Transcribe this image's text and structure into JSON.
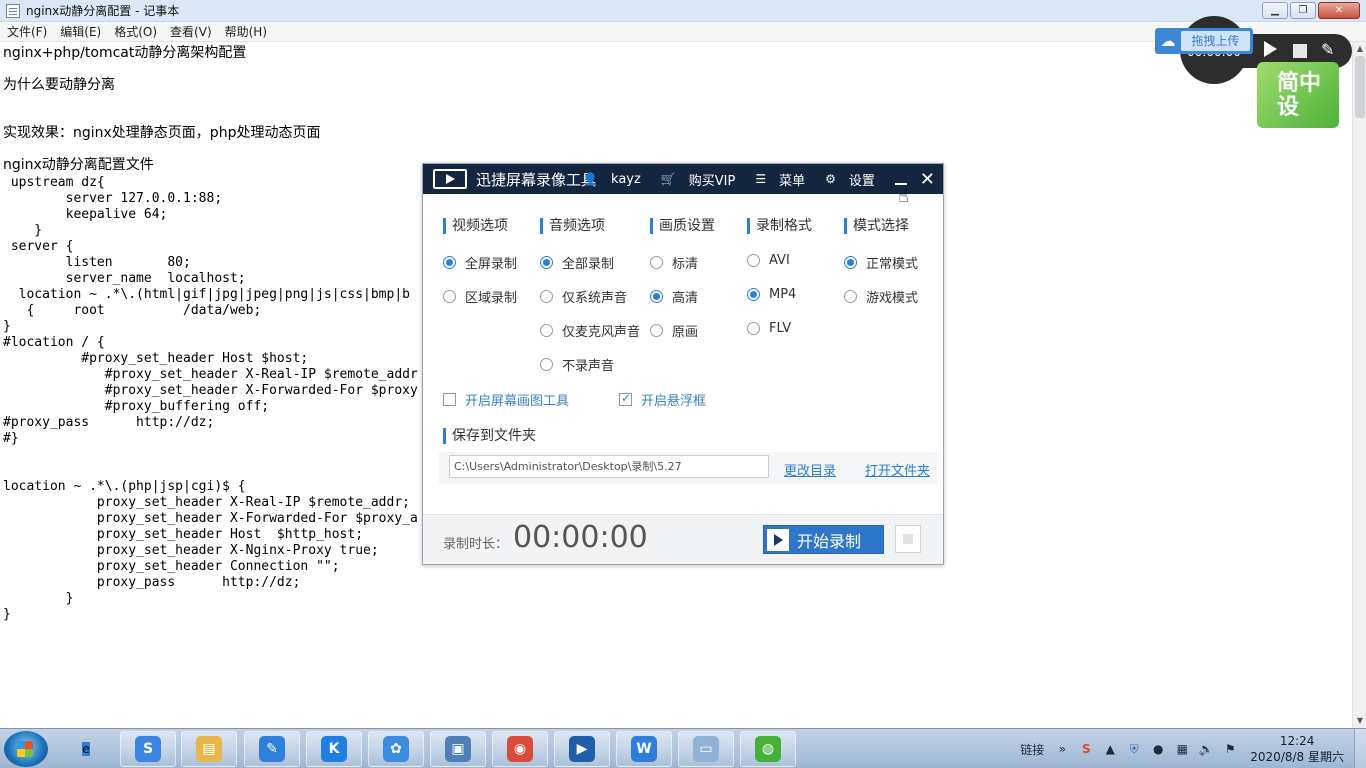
{
  "notepad": {
    "title": "nginx动静分离配置 - 记事本",
    "menu": [
      "文件(F)",
      "编辑(E)",
      "格式(O)",
      "查看(V)",
      "帮助(H)"
    ],
    "lines": [
      "nginx+php/tomcat动静分离架构配置",
      "为什么要动静分离",
      "实现效果：nginx处理静态页面，php处理动态页面",
      "nginx动静分离配置文件",
      " upstream dz{",
      "        server 127.0.0.1:88;",
      "        keepalive 64;",
      "    }",
      " server {",
      "        listen       80;",
      "        server_name  localhost;",
      "  location ~ .*\\.(html|gif|jpg|jpeg|png|js|css|bmp|b",
      "   {     root          /data/web;",
      "}",
      "#location / {",
      "          #proxy_set_header Host $host;",
      "             #proxy_set_header X-Real-IP $remote_addr",
      "             #proxy_set_header X-Forwarded-For $proxy",
      "             #proxy_buffering off;",
      "#proxy_pass      http://dz;",
      "#}",
      "location ~ .*\\.(php|jsp|cgi)$ {",
      "            proxy_set_header X-Real-IP $remote_addr;",
      "            proxy_set_header X-Forwarded-For $proxy_a",
      "            proxy_set_header Host  $http_host;",
      "            proxy_set_header X-Nginx-Proxy true;",
      "            proxy_set_header Connection \"\";",
      "            proxy_pass      http://dz;",
      "        }",
      "}"
    ]
  },
  "float_bar": {
    "timer": "00:00:00",
    "upload_label": "拖拽上传",
    "badge_text": "简中设"
  },
  "recorder": {
    "title": "迅捷屏幕录像工具",
    "user": "kayz",
    "buy_vip": "购买VIP",
    "menu": "菜单",
    "settings": "设置",
    "columns": [
      {
        "header": "视频选项",
        "options": [
          {
            "label": "全屏录制",
            "selected": true
          },
          {
            "label": "区域录制",
            "selected": false
          }
        ]
      },
      {
        "header": "音频选项",
        "options": [
          {
            "label": "全部录制",
            "selected": true
          },
          {
            "label": "仅系统声音",
            "selected": false
          },
          {
            "label": "仅麦克风声音",
            "selected": false
          },
          {
            "label": "不录声音",
            "selected": false
          }
        ]
      },
      {
        "header": "画质设置",
        "options": [
          {
            "label": "标清",
            "selected": false
          },
          {
            "label": "高清",
            "selected": true
          },
          {
            "label": "原画",
            "selected": false
          }
        ]
      },
      {
        "header": "录制格式",
        "options": [
          {
            "label": "AVI",
            "selected": false
          },
          {
            "label": "MP4",
            "selected": true
          },
          {
            "label": "FLV",
            "selected": false
          }
        ]
      },
      {
        "header": "模式选择",
        "options": [
          {
            "label": "正常模式",
            "selected": true
          },
          {
            "label": "游戏模式",
            "selected": false
          }
        ]
      }
    ],
    "checkboxes": [
      {
        "label": "开启屏幕画图工具",
        "checked": false
      },
      {
        "label": "开启悬浮框",
        "checked": true
      }
    ],
    "save_header": "保存到文件夹",
    "save_path": "C:\\Users\\Administrator\\Desktop\\录制\\5.27",
    "change_dir": "更改目录",
    "open_folder": "打开文件夹",
    "duration_label": "录制时长：",
    "duration": "00:00:00",
    "start_label": "开始录制"
  },
  "taskbar": {
    "apps": [
      {
        "name": "ie",
        "glyph": "e",
        "color": "#2b7fd2",
        "active": false
      },
      {
        "name": "browser",
        "glyph": "S",
        "color": "#3b86e0",
        "active": true
      },
      {
        "name": "file-explorer",
        "glyph": "▤",
        "color": "#e6b74a",
        "active": true
      },
      {
        "name": "notes",
        "glyph": "✎",
        "color": "#2e80d8",
        "active": true
      },
      {
        "name": "kugou",
        "glyph": "K",
        "color": "#1f7fe0",
        "active": true
      },
      {
        "name": "baidu-netdisk",
        "glyph": "✿",
        "color": "#3c8de0",
        "active": true
      },
      {
        "name": "virtualbox",
        "glyph": "▣",
        "color": "#4e7fb6",
        "active": true
      },
      {
        "name": "snail",
        "glyph": "◉",
        "color": "#d94c3a",
        "active": true
      },
      {
        "name": "screen-recorder",
        "glyph": "▶",
        "color": "#1f5ea8",
        "active": true
      },
      {
        "name": "wps",
        "glyph": "W",
        "color": "#2f7fd8",
        "active": true
      },
      {
        "name": "notepad",
        "glyph": "▭",
        "color": "#8fb3d6",
        "active": true
      },
      {
        "name": "wechat",
        "glyph": "◍",
        "color": "#46b13a",
        "active": true
      }
    ],
    "tray_link": "链接",
    "time": "12:24",
    "date": "2020/8/8 星期六"
  }
}
